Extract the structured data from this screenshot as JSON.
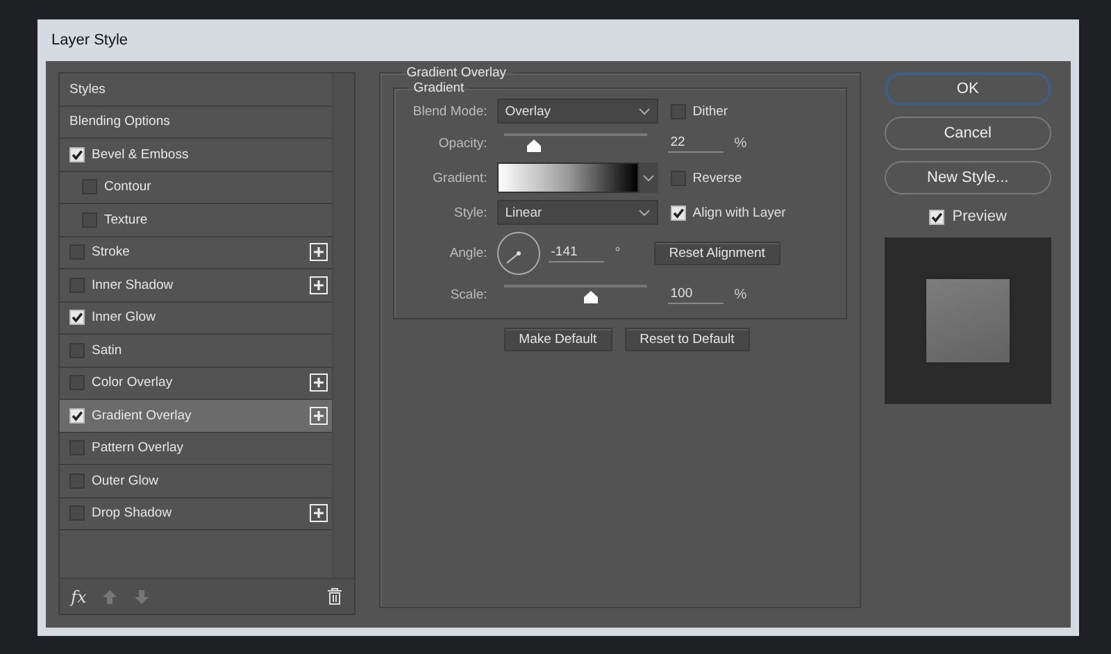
{
  "window": {
    "title": "Layer Style"
  },
  "styles_list": {
    "items": [
      {
        "label": "Styles",
        "kind": "header",
        "selected": false
      },
      {
        "label": "Blending Options",
        "kind": "header",
        "selected": false
      },
      {
        "label": "Bevel & Emboss",
        "kind": "option",
        "checked": true,
        "add": false,
        "selected": false
      },
      {
        "label": "Contour",
        "kind": "sub",
        "checked": false,
        "add": false,
        "selected": false
      },
      {
        "label": "Texture",
        "kind": "sub",
        "checked": false,
        "add": false,
        "selected": false
      },
      {
        "label": "Stroke",
        "kind": "option",
        "checked": false,
        "add": true,
        "selected": false
      },
      {
        "label": "Inner Shadow",
        "kind": "option",
        "checked": false,
        "add": true,
        "selected": false
      },
      {
        "label": "Inner Glow",
        "kind": "option",
        "checked": true,
        "add": false,
        "selected": false
      },
      {
        "label": "Satin",
        "kind": "option",
        "checked": false,
        "add": false,
        "selected": false
      },
      {
        "label": "Color Overlay",
        "kind": "option",
        "checked": false,
        "add": true,
        "selected": false
      },
      {
        "label": "Gradient Overlay",
        "kind": "option",
        "checked": true,
        "add": true,
        "selected": true
      },
      {
        "label": "Pattern Overlay",
        "kind": "option",
        "checked": false,
        "add": false,
        "selected": false
      },
      {
        "label": "Outer Glow",
        "kind": "option",
        "checked": false,
        "add": false,
        "selected": false
      },
      {
        "label": "Drop Shadow",
        "kind": "option",
        "checked": false,
        "add": true,
        "selected": false
      }
    ],
    "footer": {
      "fx_label": "fx"
    }
  },
  "gradient_overlay": {
    "title": "Gradient Overlay",
    "group_title": "Gradient",
    "blend_mode": {
      "label": "Blend Mode:",
      "value": "Overlay"
    },
    "dither": {
      "label": "Dither",
      "checked": false
    },
    "opacity": {
      "label": "Opacity:",
      "level": 0.21,
      "value": "22",
      "unit": "%"
    },
    "gradient": {
      "label": "Gradient:"
    },
    "reverse": {
      "label": "Reverse",
      "checked": false
    },
    "style": {
      "label": "Style:",
      "value": "Linear"
    },
    "align_with_layer": {
      "label": "Align with Layer",
      "checked": true
    },
    "angle": {
      "label": "Angle:",
      "value": "-141",
      "unit": "°"
    },
    "reset_alignment": "Reset Alignment",
    "scale": {
      "label": "Scale:",
      "level": 0.61,
      "value": "100",
      "unit": "%"
    },
    "buttons": [
      "Make Default",
      "Reset to Default"
    ]
  },
  "actions": [
    {
      "label": "OK",
      "kind": "default"
    },
    {
      "label": "Cancel",
      "kind": "normal"
    },
    {
      "label": "New Style...",
      "kind": "normal"
    }
  ],
  "preview": {
    "label": "Preview",
    "checked": true
  }
}
